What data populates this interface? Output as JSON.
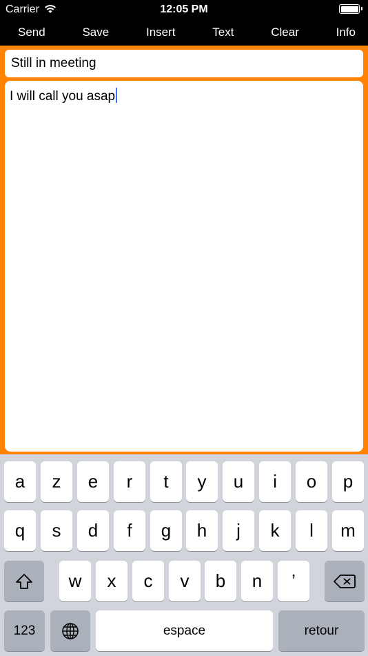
{
  "status": {
    "carrier": "Carrier",
    "time": "12:05 PM"
  },
  "toolbar": {
    "send": "Send",
    "save": "Save",
    "insert": "Insert",
    "text": "Text",
    "clear": "Clear",
    "info": "Info"
  },
  "editor": {
    "subject": "Still in meeting",
    "body": "I will call you asap"
  },
  "keyboard": {
    "row1": [
      "a",
      "z",
      "e",
      "r",
      "t",
      "y",
      "u",
      "i",
      "o",
      "p"
    ],
    "row2": [
      "q",
      "s",
      "d",
      "f",
      "g",
      "h",
      "j",
      "k",
      "l",
      "m"
    ],
    "row3": [
      "w",
      "x",
      "c",
      "v",
      "b",
      "n",
      "’"
    ],
    "numbers_key": "123",
    "space_key": "espace",
    "return_key": "retour"
  },
  "colors": {
    "accent": "#ff8200",
    "toolbar": "#000000",
    "keyboard": "#d1d4da"
  }
}
